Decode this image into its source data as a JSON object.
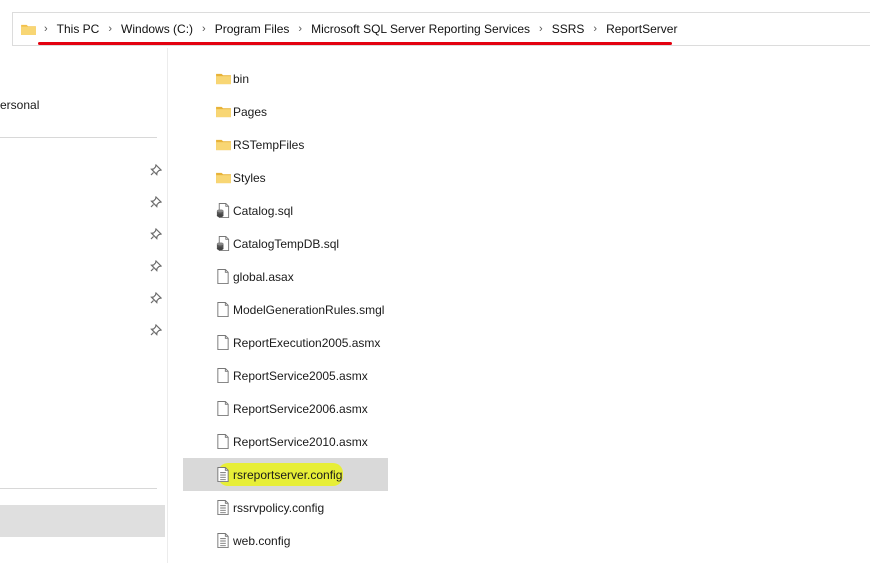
{
  "breadcrumb": {
    "items": [
      {
        "label": "This PC"
      },
      {
        "label": "Windows (C:)"
      },
      {
        "label": "Program Files"
      },
      {
        "label": "Microsoft SQL Server Reporting Services"
      },
      {
        "label": "SSRS"
      },
      {
        "label": "ReportServer"
      }
    ],
    "separator": "›"
  },
  "nav": {
    "personal_label": "ersonal"
  },
  "files": [
    {
      "name": "bin",
      "icon": "folder-icon",
      "kind": "folder"
    },
    {
      "name": "Pages",
      "icon": "folder-icon",
      "kind": "folder"
    },
    {
      "name": "RSTempFiles",
      "icon": "folder-icon",
      "kind": "folder"
    },
    {
      "name": "Styles",
      "icon": "folder-icon",
      "kind": "folder"
    },
    {
      "name": "Catalog.sql",
      "icon": "sql-file-icon",
      "kind": "sql"
    },
    {
      "name": "CatalogTempDB.sql",
      "icon": "sql-file-icon",
      "kind": "sql"
    },
    {
      "name": "global.asax",
      "icon": "document-icon",
      "kind": "doc"
    },
    {
      "name": "ModelGenerationRules.smgl",
      "icon": "document-icon",
      "kind": "doc"
    },
    {
      "name": "ReportExecution2005.asmx",
      "icon": "document-icon",
      "kind": "doc"
    },
    {
      "name": "ReportService2005.asmx",
      "icon": "document-icon",
      "kind": "doc"
    },
    {
      "name": "ReportService2006.asmx",
      "icon": "document-icon",
      "kind": "doc"
    },
    {
      "name": "ReportService2010.asmx",
      "icon": "document-icon",
      "kind": "doc"
    },
    {
      "name": "rsreportserver.config",
      "icon": "config-file-icon",
      "kind": "config",
      "selected": true,
      "highlighted": true
    },
    {
      "name": "rssrvpolicy.config",
      "icon": "config-file-icon",
      "kind": "config"
    },
    {
      "name": "web.config",
      "icon": "config-file-icon",
      "kind": "config"
    }
  ],
  "colors": {
    "annotation_underline": "#e3000f",
    "annotation_highlight": "#e8ef2e",
    "folder": "#f2c04b",
    "selection": "#d9d9d9"
  }
}
